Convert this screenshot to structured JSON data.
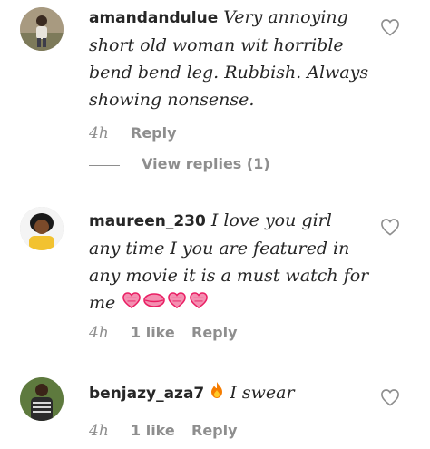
{
  "comments": [
    {
      "username": "amandandulue",
      "text_lines": [
        "Very annoying",
        "short old woman wit horrible",
        "bend bend leg. Rubbish. Always",
        "showing nonsense."
      ],
      "time": "4h",
      "likes": "",
      "reply": "Reply",
      "view_replies": "View replies (1)",
      "avatar_icon": "user-avatar"
    },
    {
      "username": "maureen_230",
      "text_lines": [
        "I love you girl",
        "any time I you are featured in",
        "any movie it is a must watch for",
        "me"
      ],
      "emojis": [
        "heart-pink-icon",
        "kiss-lips-icon",
        "heart-pink-icon",
        "heart-pink-icon"
      ],
      "time": "4h",
      "likes": "1 like",
      "reply": "Reply",
      "avatar_icon": "user-avatar"
    },
    {
      "username": "benjazy_aza7",
      "text_lines": [
        "I swear"
      ],
      "emojis": [
        "fire-icon"
      ],
      "time": "4h",
      "likes": "1 like",
      "reply": "Reply",
      "avatar_icon": "user-avatar"
    }
  ],
  "colors": {
    "text": "#262626",
    "muted": "#8e8e8e",
    "emoji_pink": "#e91e63"
  }
}
